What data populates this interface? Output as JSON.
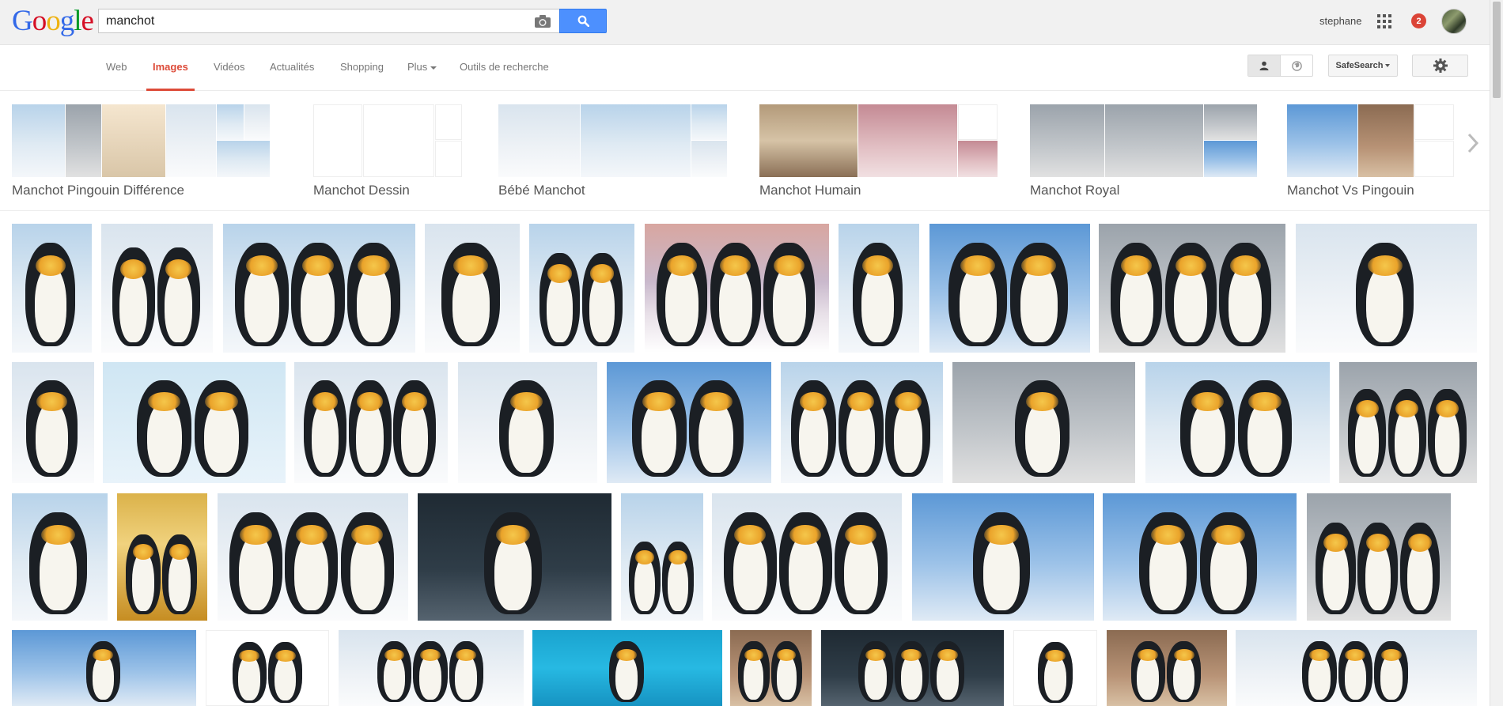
{
  "header": {
    "logo_letters": [
      {
        "ch": "G",
        "color": "#3369e8"
      },
      {
        "ch": "o",
        "color": "#d50f25"
      },
      {
        "ch": "o",
        "color": "#eeb211"
      },
      {
        "ch": "g",
        "color": "#3369e8"
      },
      {
        "ch": "l",
        "color": "#009925"
      },
      {
        "ch": "e",
        "color": "#d50f25"
      }
    ],
    "search_value": "manchot",
    "user_name": "stephane",
    "notification_count": "2",
    "icons": {
      "camera": "camera-icon",
      "search": "magnifier-icon",
      "apps": "apps-grid-icon",
      "avatar": "user-avatar"
    }
  },
  "nav": {
    "tabs": [
      {
        "label": "Web",
        "active": false
      },
      {
        "label": "Images",
        "active": true
      },
      {
        "label": "Vidéos",
        "active": false
      },
      {
        "label": "Actualités",
        "active": false
      },
      {
        "label": "Shopping",
        "active": false
      },
      {
        "label": "Plus",
        "active": false,
        "dropdown": true
      },
      {
        "label": "Outils de recherche",
        "active": false
      }
    ],
    "safesearch_label": "SafeSearch",
    "accent_color": "#dd4b39"
  },
  "related": [
    {
      "label": "Manchot Pingouin Différence"
    },
    {
      "label": "Manchot Dessin"
    },
    {
      "label": "Bébé Manchot"
    },
    {
      "label": "Manchot Humain"
    },
    {
      "label": "Manchot Royal"
    },
    {
      "label": "Manchot Vs Pingouin"
    }
  ],
  "colors": {
    "search_button": "#4d90fe",
    "badge": "#db4437"
  }
}
